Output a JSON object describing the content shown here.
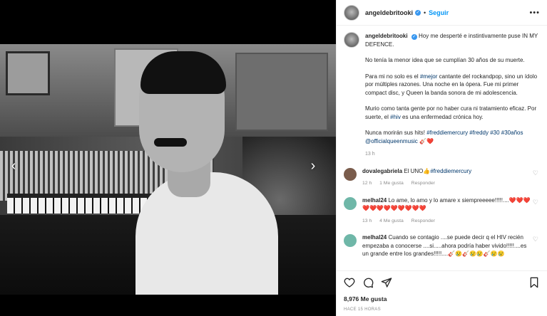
{
  "nav": {
    "prev_arrow": "‹",
    "next_arrow": "›"
  },
  "header": {
    "username": "angeldebritooki",
    "separator": "•",
    "follow_label": "Seguir",
    "more_label": "•••"
  },
  "caption": {
    "username": "angeldebritooki",
    "line1": "Hoy me desperté e instintivamente puse IN MY DEFENCE.",
    "para2": "No tenía la menor idea que se cumplían 30 años de su muerte.",
    "para3_a": "Para mi no solo es el ",
    "para3_tag": "#mejor",
    "para3_b": " cantante del rockandpop, sino un ídolo por múltiples razones. Una noche en la ópera. Fue mi primer compact disc, y Queen la banda sonora de mi adolescencia.",
    "para4_a": "Murio como tanta gente por no haber cura ni tratamiento eficaz. Por suerte, el ",
    "para4_tag": "#hiv",
    "para4_b": " es una enfermedad crónica hoy.",
    "para5_a": "Nunca morirán sus hits! ",
    "para5_tags": "#freddiemercury #freddy #30 #30años @officialqueenmusic",
    "para5_emoji": " 🎸❤️",
    "time": "13 h"
  },
  "comments": [
    {
      "username": "dovalegabriela",
      "text_a": " El UNO👍",
      "text_tag": "#freddiemercury",
      "text_b": "",
      "time": "12 h",
      "likes": "1 Me gusta",
      "reply": "Responder",
      "avatar_color": "#7a5c4c"
    },
    {
      "username": "melhal24",
      "text_a": " Lo ame, lo amo y lo amare x siempreeeee!!!!!....❤️❤️❤️❤️❤️❤️❤️❤️❤️❤️❤️❤️",
      "text_tag": "",
      "text_b": "",
      "time": "13 h",
      "likes": "4 Me gusta",
      "reply": "Responder",
      "avatar_color": "#6fb7a8"
    },
    {
      "username": "melhal24",
      "text_a": " Cuando se contagio ....se puede decir q el HIV recién empezaba a conocerse ....si.....ahora podría haber vivido!!!!!....es un grande entre los grandes!!!!!....🎸😢🎸😢😢🎸😢😢",
      "text_tag": "",
      "text_b": "",
      "time": "",
      "likes": "",
      "reply": "",
      "avatar_color": "#6fb7a8"
    }
  ],
  "actions": {
    "likes": "8,976 Me gusta",
    "ago": "HACE 15 HORAS"
  },
  "colors": {
    "accent": "#0095f6",
    "hashtag": "#00376b",
    "muted": "#8e8e8e"
  }
}
